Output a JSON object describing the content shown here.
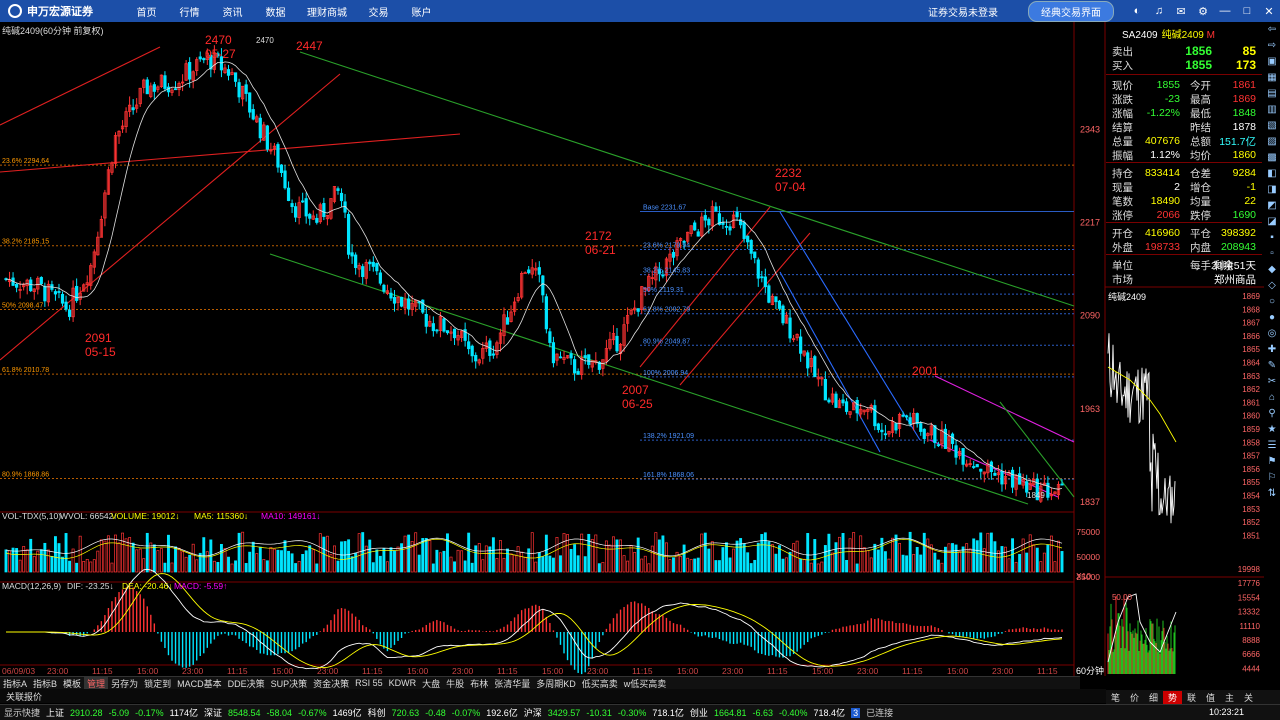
{
  "app": {
    "logo": "申万宏源证券",
    "nav": [
      "首页",
      "行情",
      "资讯",
      "数据",
      "理财商城",
      "交易",
      "账户"
    ],
    "login_text": "证券交易未登录",
    "classic_btn": "经典交易界面"
  },
  "chart_header": "纯碱2409(60分钟 前复权)",
  "main": {
    "price_labels": [
      "2343",
      "2217",
      "2090",
      "1963",
      "1837"
    ],
    "fib_left": [
      "23.6% 2294.64",
      "38.2% 2185.15",
      "50% 2098.47",
      "61.8% 2010.78",
      "80.9% 1868.86"
    ],
    "fib_right": [
      "Base 2231.67",
      "23.6% 2179.94",
      "38.2% 2145.83",
      "50% 2119.31",
      "61.8% 2092.79",
      "80.9% 2049.87",
      "100% 2006.94",
      "138.2% 1921.09",
      "161.8% 1868.06"
    ],
    "annots": [
      {
        "t": "2470",
        "s": "05-27"
      },
      {
        "t": "2447",
        "s": ""
      },
      {
        "t": "2091",
        "s": "05-15"
      },
      {
        "t": "2172",
        "s": "06-21"
      },
      {
        "t": "2007",
        "s": "06-25"
      },
      {
        "t": "2232",
        "s": "07-04"
      },
      {
        "t": "2001",
        "s": ""
      }
    ],
    "hi_mark": "2470",
    "last_mark": "1849"
  },
  "vol": {
    "title": "VOL-TDX(5,10)",
    "wvol": "WVOL: 66542↑",
    "volume": "VOLUME: 19012↓",
    "ma5": "MA5: 115360↓",
    "ma10": "MA10: 149161↓",
    "axis": [
      "75000",
      "50000",
      "25000"
    ],
    "mult": "X10"
  },
  "macd": {
    "title": "MACD(12,26,9)",
    "dif": "DIF: -23.25↓",
    "dea": "DEA: -20.46↓",
    "macd": "MACD: -5.59↑"
  },
  "time_labels": [
    "06/09/03",
    "23:00",
    "11:15",
    "15:00",
    "23:00",
    "11:15",
    "15:00",
    "23:00",
    "11:15",
    "15:00",
    "23:00",
    "11:15",
    "15:00",
    "23:00",
    "11:15",
    "15:00",
    "23:00",
    "11:15",
    "15:00",
    "23:00",
    "11:15",
    "15:00",
    "23:00",
    "11:15"
  ],
  "quote": {
    "code": "SA2409",
    "name": "纯碱2409",
    "mark": "M",
    "ask": {
      "label": "卖出",
      "price": "1856",
      "vol": "85"
    },
    "bid": {
      "label": "买入",
      "price": "1855",
      "vol": "173"
    },
    "rows": [
      [
        "现价",
        "1855",
        "今开",
        "1861"
      ],
      [
        "涨跌",
        "-23",
        "最高",
        "1869"
      ],
      [
        "涨幅",
        "-1.22%",
        "最低",
        "1848"
      ],
      [
        "结算",
        "",
        "昨结",
        "1878"
      ],
      [
        "总量",
        "407676",
        "总额",
        "151.7亿"
      ],
      [
        "振幅",
        "1.12%",
        "均价",
        "1860"
      ],
      [
        "持仓",
        "833414",
        "仓差",
        "9284"
      ],
      [
        "现量",
        "2",
        "增仓",
        "-1"
      ],
      [
        "笔数",
        "18490",
        "均量",
        "22"
      ],
      [
        "涨停",
        "2066",
        "跌停",
        "1690"
      ],
      [
        "开仓",
        "416960",
        "平仓",
        "398392"
      ],
      [
        "外盘",
        "198733",
        "内盘",
        "208943"
      ],
      [
        "单位",
        "",
        "每手20吨",
        "剩余51天"
      ],
      [
        "市场",
        "",
        "",
        "郑州商品"
      ]
    ]
  },
  "mini": {
    "title": "纯碱2409",
    "prices": [
      "1869",
      "1868",
      "1867",
      "1866",
      "1865",
      "1864",
      "1863",
      "1862",
      "1861",
      "1860",
      "1859",
      "1858",
      "1857",
      "1856",
      "1855",
      "1854",
      "1853",
      "1852",
      "1851"
    ],
    "vol_top": "50.00",
    "bottom": [
      "19998",
      "17776",
      "15554",
      "13332",
      "11110",
      "8888",
      "6666",
      "4444",
      "2222"
    ]
  },
  "period": "60分钟",
  "bottom_tabs": [
    "指标A",
    "指标B",
    "模板",
    "管理",
    "另存为",
    "锁定到",
    "MACD基本",
    "DDE决策",
    "SUP决策",
    "资金决策",
    "RSI 55",
    "KDWR",
    "大盘",
    "牛股",
    "布林",
    "张清华量",
    "多周期KD",
    "低买高卖",
    "w低买高卖"
  ],
  "right_tabs": [
    "笔",
    "价",
    "细",
    "势",
    "联",
    "值",
    "主",
    "关"
  ],
  "alarm": "关联报价",
  "status": {
    "show_quick": "显示快捷",
    "items": [
      {
        "n": "上证",
        "v": "2910.28",
        "c": "-5.09",
        "p": "-0.17%",
        "a": "1174亿"
      },
      {
        "n": "深证",
        "v": "8548.54",
        "c": "-58.04",
        "p": "-0.67%",
        "a": "1469亿"
      },
      {
        "n": "科创",
        "v": "720.63",
        "c": "-0.48",
        "p": "-0.07%",
        "a": "192.6亿"
      },
      {
        "n": "沪深",
        "v": "3429.57",
        "c": "-10.31",
        "p": "-0.30%",
        "a": "718.1亿"
      },
      {
        "n": "创业",
        "v": "1664.81",
        "c": "-6.63",
        "p": "-0.40%",
        "a": "718.4亿"
      }
    ],
    "conn_num": "3",
    "conn_text": "已连接",
    "time": "10:23:21"
  },
  "colors": {
    "up": "#ff3333",
    "down": "#00e5ff",
    "ma": "#ffffff",
    "bg": "#000000",
    "topbar": "#1c4fa8"
  }
}
